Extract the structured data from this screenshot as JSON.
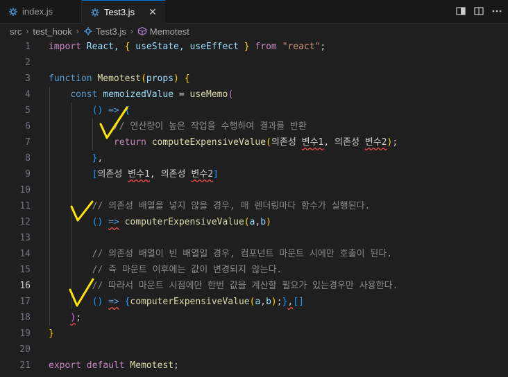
{
  "tabs": [
    {
      "label": "index.js",
      "icon": "javascript-file-icon",
      "active": false
    },
    {
      "label": "Test3.js",
      "icon": "javascript-file-icon",
      "active": true
    }
  ],
  "close_glyph": "✕",
  "actions": [
    "toggle-panel-icon",
    "split-editor-icon",
    "more-actions-icon"
  ],
  "breadcrumb": [
    "src",
    "test_hook",
    "Test3.js",
    "Memotest"
  ],
  "colors": {
    "keyword": "#569cd6",
    "control": "#c586c0",
    "function": "#dcdcaa",
    "variable": "#9cdcfe",
    "string": "#ce9178",
    "comment": "#6a9955",
    "annotation": "#ffe600"
  },
  "lines": [
    {
      "n": "1",
      "tokens": [
        [
          "import",
          "ctl"
        ],
        [
          " React, ",
          "var"
        ],
        [
          "{",
          "b1"
        ],
        [
          " useState, useEffect ",
          "var"
        ],
        [
          "}",
          "b1"
        ],
        [
          " from ",
          "ctl"
        ],
        [
          "\"react\"",
          "str"
        ],
        [
          ";",
          ""
        ]
      ]
    },
    {
      "n": "2",
      "tokens": []
    },
    {
      "n": "3",
      "tokens": [
        [
          "function ",
          "kw"
        ],
        [
          "Memotest",
          "fn"
        ],
        [
          "(",
          "b1"
        ],
        [
          "props",
          "var"
        ],
        [
          ")",
          "b1"
        ],
        [
          " ",
          ""
        ],
        [
          "{",
          "b1"
        ]
      ]
    },
    {
      "n": "4",
      "tokens": [
        [
          "    ",
          ""
        ],
        [
          "const ",
          "kw"
        ],
        [
          "memoizedValue",
          "var"
        ],
        [
          " = ",
          ""
        ],
        [
          "useMemo",
          "fn"
        ],
        [
          "(",
          "b2"
        ]
      ]
    },
    {
      "n": "5",
      "tokens": [
        [
          "        ",
          ""
        ],
        [
          "()",
          "b3"
        ],
        [
          " ",
          ""
        ],
        [
          "=>",
          "kw"
        ],
        [
          " ",
          ""
        ],
        [
          "{",
          "b3"
        ]
      ]
    },
    {
      "n": "6",
      "tokens": [
        [
          "            ",
          ""
        ],
        [
          "// 연산량이 높은 작업을 수행하여 결과를 반환",
          "cmg"
        ]
      ]
    },
    {
      "n": "7",
      "tokens": [
        [
          "            ",
          ""
        ],
        [
          "return ",
          "ctl"
        ],
        [
          "computeExpensiveValue",
          "fn"
        ],
        [
          "(",
          "b1"
        ],
        [
          "의존성 ",
          ""
        ],
        [
          "변수1",
          "wv"
        ],
        [
          ", 의존성 ",
          ""
        ],
        [
          "변수2",
          "wv"
        ],
        [
          ")",
          "b1"
        ],
        [
          ";",
          ""
        ]
      ]
    },
    {
      "n": "8",
      "tokens": [
        [
          "        ",
          ""
        ],
        [
          "}",
          "b3"
        ],
        [
          ",",
          ""
        ]
      ]
    },
    {
      "n": "9",
      "tokens": [
        [
          "        ",
          ""
        ],
        [
          "[",
          "b3"
        ],
        [
          "의존성 ",
          ""
        ],
        [
          "변수1",
          "wv"
        ],
        [
          ", 의존성 ",
          ""
        ],
        [
          "변수2",
          "wv"
        ],
        [
          "]",
          "b3"
        ]
      ]
    },
    {
      "n": "10",
      "tokens": []
    },
    {
      "n": "11",
      "tokens": [
        [
          "        ",
          ""
        ],
        [
          "// 의존성 배열을 넣지 않을 경우, 매 렌더링마다 함수가 실행된다.",
          "cmg"
        ]
      ]
    },
    {
      "n": "12",
      "tokens": [
        [
          "        ",
          ""
        ],
        [
          "()",
          "b3"
        ],
        [
          " ",
          ""
        ],
        [
          "=>",
          "kw wv"
        ],
        [
          " ",
          ""
        ],
        [
          "computerExpensiveValue",
          "fn"
        ],
        [
          "(",
          "b1"
        ],
        [
          "a",
          "var"
        ],
        [
          ",",
          ""
        ],
        [
          "b",
          "var"
        ],
        [
          ")",
          "b1"
        ]
      ]
    },
    {
      "n": "13",
      "tokens": []
    },
    {
      "n": "14",
      "tokens": [
        [
          "        ",
          ""
        ],
        [
          "// 의존성 배열이 빈 배열일 경우, 컴포넌트 마운트 시에만 호출이 된다.",
          "cmg"
        ]
      ]
    },
    {
      "n": "15",
      "tokens": [
        [
          "        ",
          ""
        ],
        [
          "// 즉 마운트 이후에는 값이 변경되지 않는다.",
          "cmg"
        ]
      ]
    },
    {
      "n": "16",
      "tokens": [
        [
          "        ",
          ""
        ],
        [
          "// 따라서 마운트 시점에만 한번 값을 계산할 필요가 있는경우만 사용한다.",
          "cmg"
        ]
      ]
    },
    {
      "n": "17",
      "tokens": [
        [
          "        ",
          ""
        ],
        [
          "()",
          "b3"
        ],
        [
          " ",
          ""
        ],
        [
          "=>",
          "kw wv"
        ],
        [
          " ",
          ""
        ],
        [
          "{",
          "b3"
        ],
        [
          "computerExpensiveValue",
          "fn"
        ],
        [
          "(",
          "b1"
        ],
        [
          "a",
          "var"
        ],
        [
          ",",
          ""
        ],
        [
          "b",
          "var"
        ],
        [
          ")",
          "b1"
        ],
        [
          ";",
          ""
        ],
        [
          "}",
          "b3"
        ],
        [
          ",",
          "wv"
        ],
        [
          "[",
          "b3"
        ],
        [
          "]",
          "b3"
        ]
      ]
    },
    {
      "n": "18",
      "tokens": [
        [
          "    ",
          ""
        ],
        [
          ")",
          "b2 wv"
        ],
        [
          ";",
          ""
        ]
      ]
    },
    {
      "n": "19",
      "tokens": [
        [
          "}",
          "b1"
        ]
      ]
    },
    {
      "n": "20",
      "tokens": []
    },
    {
      "n": "21",
      "tokens": [
        [
          "export ",
          "ctl"
        ],
        [
          "default ",
          "ctl"
        ],
        [
          "Memotest",
          "fn"
        ],
        [
          ";",
          ""
        ]
      ]
    }
  ]
}
